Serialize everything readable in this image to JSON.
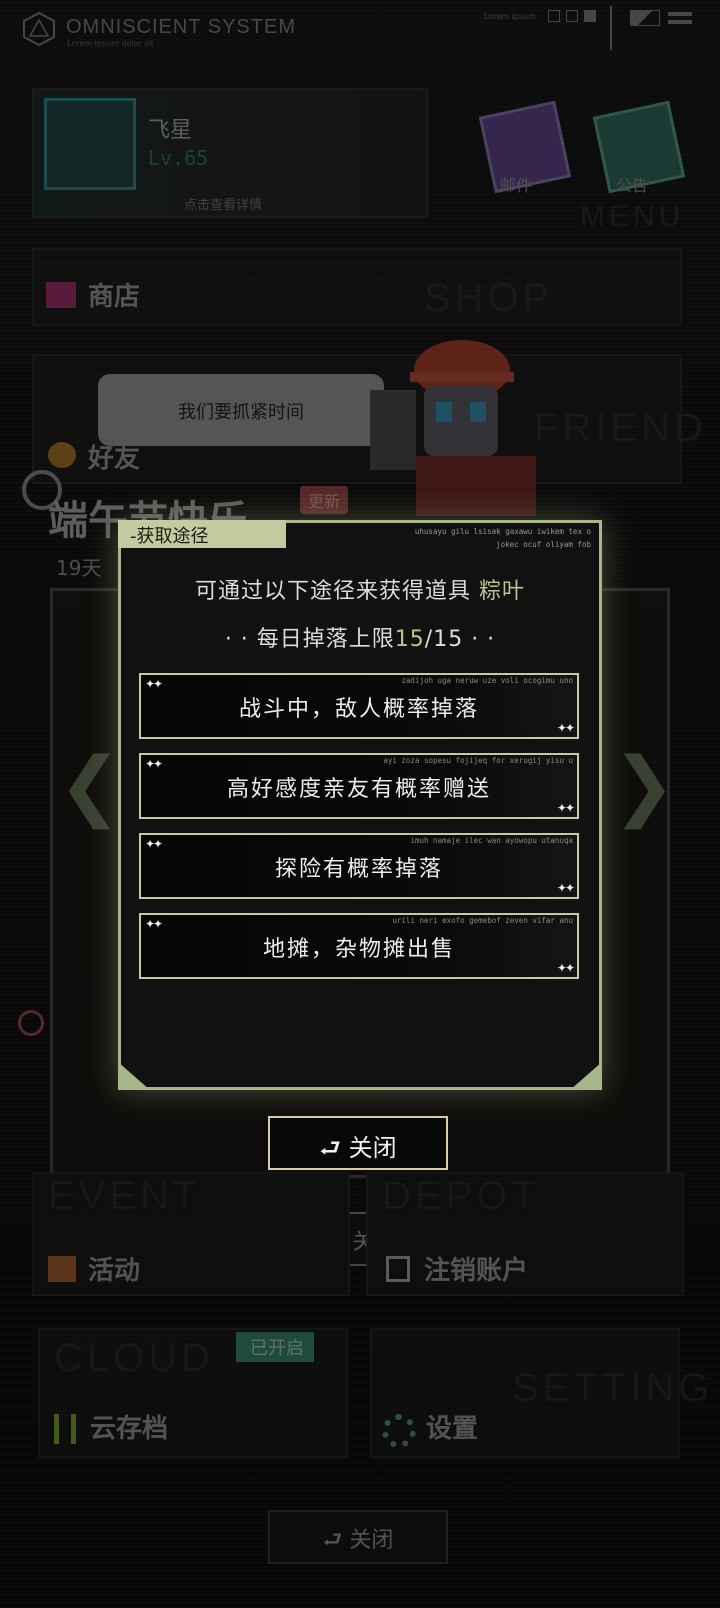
{
  "system": {
    "title": "OMNISCIENT  SYSTEM",
    "subtitle": "Lorem ipsum dolor sit",
    "small_label": "Lorem ipsum"
  },
  "profile": {
    "name": "飞星",
    "level": "Lv.65",
    "detail": "点击查看详情"
  },
  "top_icons": {
    "mail": "邮件",
    "notice": "公告",
    "menu_ghost": "MENU"
  },
  "shop": {
    "label": "商店",
    "ghost": "SHOP"
  },
  "friend": {
    "label": "好友",
    "ghost": "FRIEND",
    "speech": "我们要抓紧时间"
  },
  "event": {
    "title": "端午节快乐",
    "tag": "更新",
    "days": "19天"
  },
  "bottom": {
    "activity": "活动",
    "activity_ghost": "EVENT",
    "logout": "注销账户",
    "logout_ghost": "DEPOT",
    "cloud": "云存档",
    "cloud_ghost": "CLOUD",
    "cloud_badge": "已开启",
    "setting": "设置",
    "setting_ghost": "SETTING"
  },
  "bg_close": "关闭",
  "modal": {
    "tab": "-获取途径",
    "code": "uhusayu gilu lsisak gaxawu iwikem tex o\njokec ocuf oliyam fob",
    "desc_prefix": "可通过以下途径来获得道具 ",
    "item": "粽叶",
    "limit_prefix": "· · 每日掉落上限",
    "limit_current": "15",
    "limit_sep": "/15",
    "limit_suffix": " · ·",
    "sources": [
      {
        "label": "战斗中，敌人概率掉落",
        "code": "zadijoh uga neruw uze voli ocogimu uno"
      },
      {
        "label": "高好感度亲友有概率赠送",
        "code": "ayi zoza sopesu fojijeq for xerugij yisu u"
      },
      {
        "label": "探险有概率掉落",
        "code": "imuh namaje ilec wan ayowopu utanuqa"
      },
      {
        "label": "地摊，杂物摊出售",
        "code": "urili neri exofo gemebof zeven vifar anu"
      }
    ],
    "close": "关闭"
  },
  "colors": {
    "accent": "#b9c48f",
    "frame": "#a8b68a",
    "close_border": "#d9cba6"
  }
}
